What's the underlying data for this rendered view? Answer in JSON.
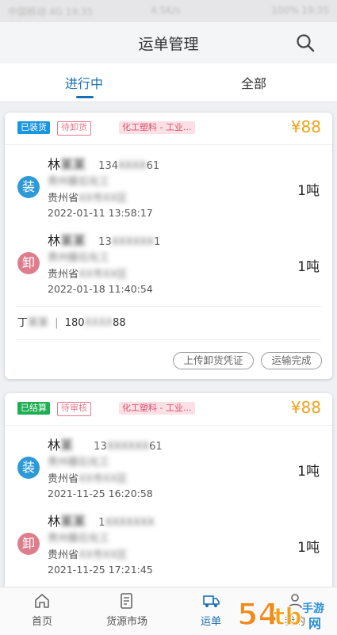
{
  "statusbar": {
    "left": "中国移动 4G 19:35",
    "mid": "4.5K/s",
    "right": "100% 19:35"
  },
  "header": {
    "title": "运单管理",
    "search_icon": "search-icon"
  },
  "tabs": [
    {
      "label": "进行中",
      "active": true
    },
    {
      "label": "全部",
      "active": false
    }
  ],
  "cards": [
    {
      "badge_state": "已装货",
      "badge_sub": "待卸货",
      "category": "化工塑料 - 工业...",
      "price": "¥88",
      "load": {
        "icon_text": "装",
        "name": "林",
        "name_blur": "某某",
        "phone_a": "134",
        "phone_blur": "XXXX",
        "phone_b": "61",
        "company_blur": "贵州磐石化工",
        "province": "贵州省",
        "addr_blur": "XX市XX区",
        "time": "2022-01-11 13:58:17",
        "weight": "1吨"
      },
      "unload": {
        "icon_text": "卸",
        "name": "林",
        "name_blur": "某某",
        "phone_a": "13",
        "phone_blur": "XXXXXX",
        "phone_b": "1",
        "company_blur": "贵州磐石化工",
        "province": "贵州省",
        "addr_blur": "XX市XX区",
        "time": "2022-01-18 11:40:54",
        "weight": "1吨"
      },
      "driver": {
        "name": "丁",
        "name_blur": "某某",
        "sep": "|",
        "phone_a": "180",
        "phone_blur": "XXXX",
        "phone_b": "88"
      },
      "buttons": {
        "upload": "上传卸货凭证",
        "complete": "运输完成"
      }
    },
    {
      "badge_state": "已结算",
      "badge_sub": "待审核",
      "category": "化工塑料 - 工业...",
      "price": "¥88",
      "load": {
        "icon_text": "装",
        "name": "林",
        "name_blur": "某",
        "phone_a": "13",
        "phone_blur": "XXXXXX",
        "phone_b": "61",
        "company_blur": "贵州磐石化工",
        "province": "贵州省",
        "addr_blur": "XX市XX区",
        "time": "2021-11-25 16:20:58",
        "weight": "1吨"
      },
      "unload": {
        "icon_text": "卸",
        "name": "林",
        "name_blur": "某某",
        "phone_a": "1",
        "phone_blur": "XXXXXXX",
        "phone_b": "",
        "company_blur": "贵州磐石化工",
        "province": "贵州省",
        "addr_blur": "XX市XX区",
        "time": "2021-11-25 17:21:45",
        "weight": "1吨"
      }
    }
  ],
  "bottomnav": [
    {
      "label": "首页",
      "icon": "home-icon"
    },
    {
      "label": "货源市场",
      "icon": "market-icon"
    },
    {
      "label": "运单",
      "icon": "truck-icon"
    },
    {
      "label": "我的",
      "icon": "user-icon"
    }
  ],
  "watermark": {
    "text": "54tb手游网"
  },
  "colors": {
    "accent": "#1a6fb2",
    "price": "#f0a21a",
    "load": "#2d9ad7",
    "unload": "#de7e8d"
  }
}
